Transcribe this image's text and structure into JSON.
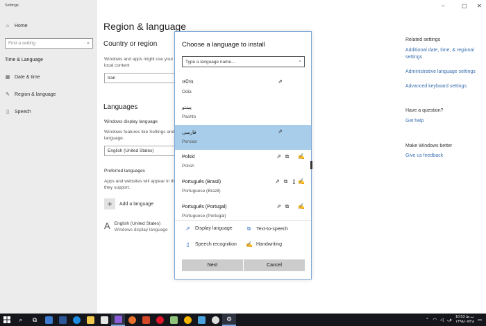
{
  "window": {
    "title": "Settings",
    "controls": [
      "–",
      "▢",
      "✕"
    ]
  },
  "nav": {
    "home_label": "Home",
    "search_placeholder": "Find a setting",
    "section_title": "Time & Language",
    "items": [
      {
        "label": "Date & time",
        "icon": "calendar-icon"
      },
      {
        "label": "Region & language",
        "icon": "pen-icon"
      },
      {
        "label": "Speech",
        "icon": "microphone-icon"
      }
    ]
  },
  "main": {
    "title": "Region & language",
    "country": {
      "heading": "Country or region",
      "desc_line1": "Windows and apps might use your",
      "desc_line2": "local content",
      "value": "Iran"
    },
    "languages": {
      "heading": "Languages",
      "display_label": "Windows display language",
      "display_desc_line1": "Windows features like Settings and",
      "display_desc_line2": "language.",
      "display_value": "English (United States)",
      "preferred_label": "Preferred languages",
      "preferred_desc_line1": "Apps and websites will appear in th",
      "preferred_desc_line2": "they support.",
      "add_label": "Add a language",
      "entry_name": "English (United States)",
      "entry_sub": "Windows display language"
    }
  },
  "related": {
    "heading": "Related settings",
    "links": [
      "Additional date, time, & regional",
      "settings",
      "Administrative language settings",
      "Advanced keyboard settings"
    ],
    "question_heading": "Have a question?",
    "help_link": "Get help",
    "better_heading": "Make Windows better",
    "feedback_link": "Give us feedback"
  },
  "dialog": {
    "title": "Choose a language to install",
    "search_placeholder": "Type a language name...",
    "languages": [
      {
        "native": "ଓଡ଼ିଆ",
        "english": "Odia",
        "features": [
          "pen"
        ]
      },
      {
        "native": "پښتو",
        "english": "Pashto",
        "features": []
      },
      {
        "native": "فارسی",
        "english": "Persian",
        "features": [
          "pen"
        ],
        "selected": true
      },
      {
        "native": "Polski",
        "english": "Polish",
        "features": [
          "pen",
          "tts",
          "hw"
        ]
      },
      {
        "native": "Português (Brasil)",
        "english": "Portuguese (Brazil)",
        "features": [
          "pen",
          "tts",
          "mic",
          "hw"
        ]
      },
      {
        "native": "Português (Portugal)",
        "english": "Portuguese (Portugal)",
        "features": [
          "pen",
          "tts",
          "hw"
        ]
      }
    ],
    "legend": {
      "display": "Display language",
      "tts": "Text-to-speech",
      "speech": "Speech recognition",
      "handwriting": "Handwriting"
    },
    "next_label": "Next",
    "cancel_label": "Cancel"
  },
  "taskbar": {
    "time": "10:53 ب.ظ",
    "date": "۱۳۹۸/۰۷/۲۸",
    "tray_icons": [
      "chevron-up-icon",
      "network-icon",
      "speaker-icon",
      "keyboard-language-icon",
      "notification-icon"
    ]
  }
}
